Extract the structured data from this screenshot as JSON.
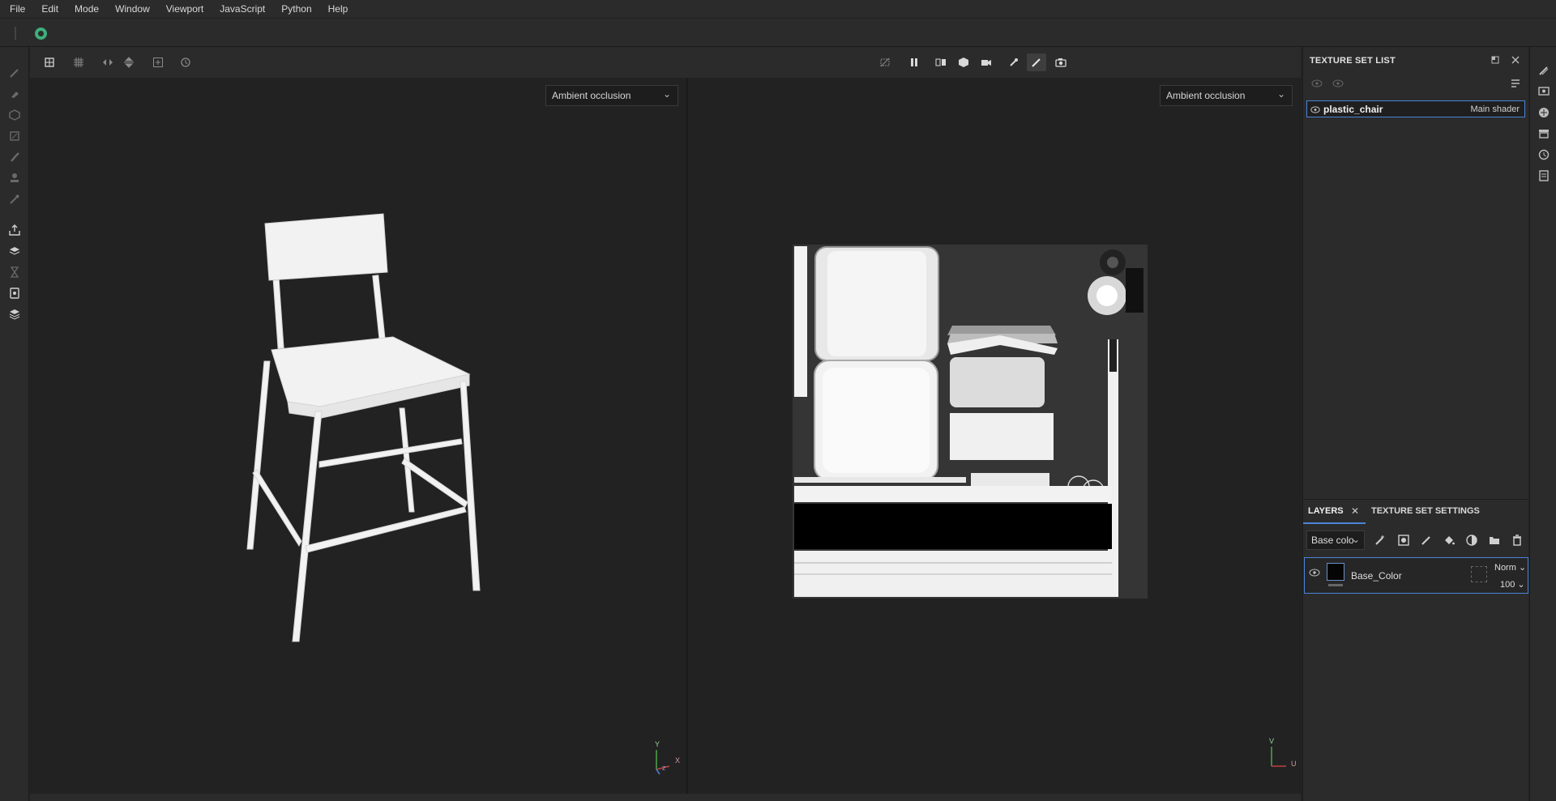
{
  "menu": [
    "File",
    "Edit",
    "Mode",
    "Window",
    "Viewport",
    "JavaScript",
    "Python",
    "Help"
  ],
  "viewport_3d": {
    "channel": "Ambient occlusion",
    "axis_y": "Y",
    "axis_x": "X",
    "axis_z": "Z"
  },
  "viewport_2d": {
    "channel": "Ambient occlusion",
    "axis_v": "V",
    "axis_u": "U"
  },
  "texture_set_list": {
    "title": "TEXTURE SET LIST",
    "items": [
      {
        "name": "plastic_chair",
        "shader": "Main shader"
      }
    ]
  },
  "layers_panel": {
    "tabs": [
      "LAYERS",
      "TEXTURE SET SETTINGS"
    ],
    "channel": "Base colo",
    "layers": [
      {
        "name": "Base_Color",
        "blend": "Norm",
        "opacity": "100"
      }
    ]
  },
  "colors": {
    "accent": "#4b84d8",
    "logo": "#3fae7c",
    "background": "#222222",
    "panel": "#2b2b2b"
  }
}
